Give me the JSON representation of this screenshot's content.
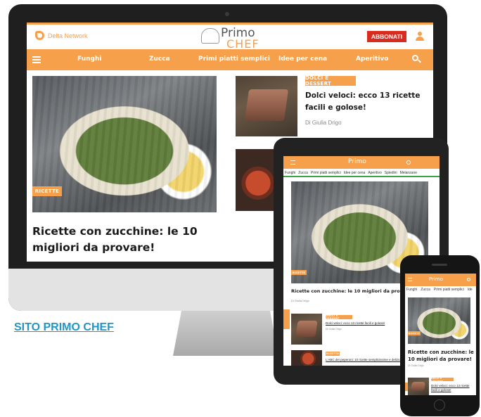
{
  "caption": "SITO PRIMO CHEF",
  "brand": {
    "network": "Delta Network",
    "logo_top": "Primo",
    "logo_bottom": "CHEF",
    "subscribe": "ABBONATI"
  },
  "nav": {
    "items": [
      "Funghi",
      "Zucca",
      "Primi piatti semplici",
      "Idee per cena",
      "Aperitivo"
    ]
  },
  "tablet_nav": {
    "items": [
      "Funghi",
      "Zucca",
      "Primi piatti semplici",
      "Idee per cena",
      "Aperitivo",
      "Spiedini",
      "Melanzane"
    ]
  },
  "phone_nav": {
    "items": [
      "Funghi",
      "Zucca",
      "Primi piatti semplici",
      "Ide"
    ]
  },
  "featured": {
    "tag": "RICETTE",
    "title": "Ricette con zucchine: le 10 migliori da provare!"
  },
  "side_article": {
    "tag": "DOLCI E DESSERT",
    "title": "Dolci veloci: ecco 13 ricette facili e golose!",
    "author": "Di Giulia Drigo"
  },
  "tablet": {
    "featured_tag": "RICETTE",
    "featured_title": "Ricette con zucchine: le 10 migliori da provare!",
    "featured_author": "Di Giulia Drigo",
    "item1_tag": "DOLCI E DESSERT",
    "item1_title": "Dolci veloci: ecco 13 ricette facili e golose!",
    "item1_author": "Di Giulia Drigo",
    "item2_tag": "RICETTE",
    "item2_title": "L'ABC dei peperoni: 10 ricette semplicissime e deliziose"
  },
  "phone": {
    "featured_tag": "RICETTE",
    "featured_title": "Ricette con zucchine: le 10 migliori da provare!",
    "featured_author": "Di Giulia Drigo",
    "item1_tag": "DOLCI E DESSERT",
    "item1_title": "Dolci veloci: ecco 13 ricette facili e golose!"
  },
  "colors": {
    "accent": "#f7a04b",
    "subscribe": "#d62d20",
    "link": "#2196c7"
  }
}
